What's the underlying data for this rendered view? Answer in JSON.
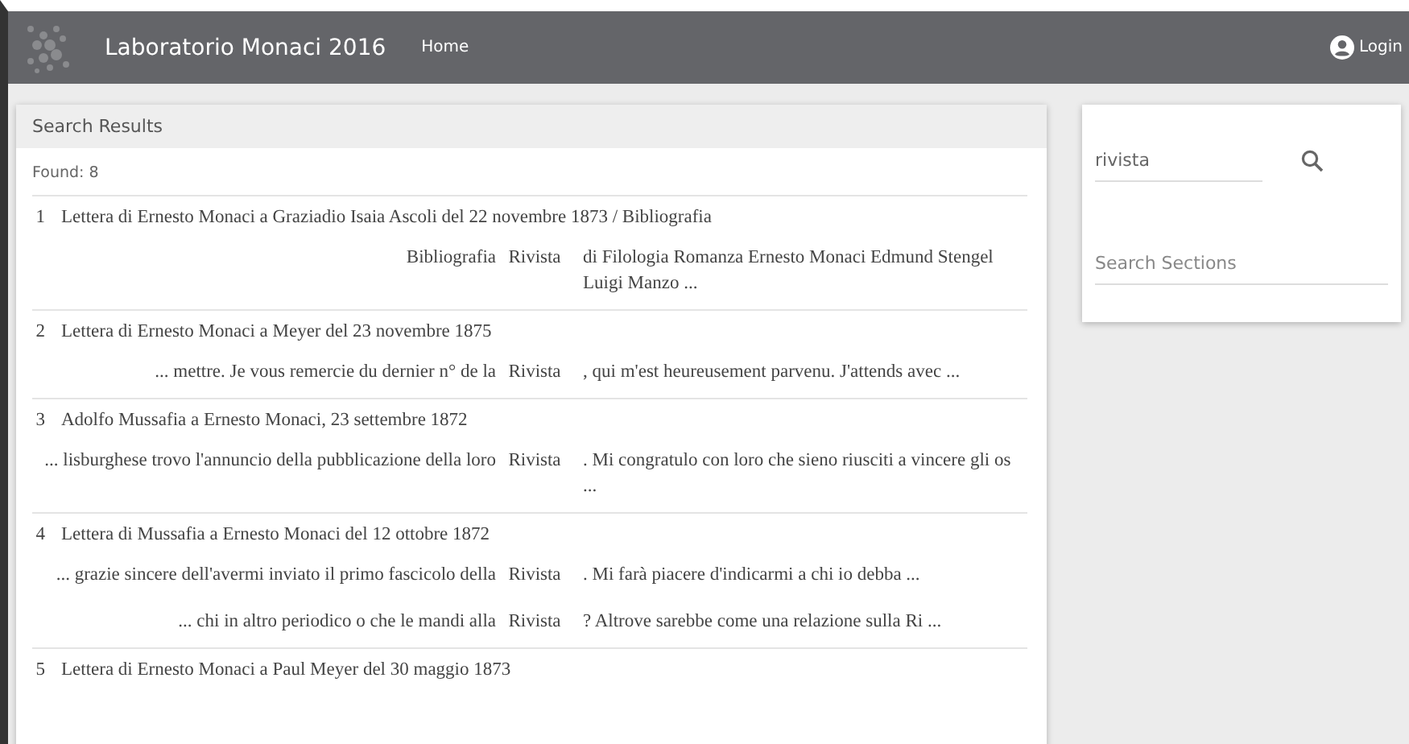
{
  "header": {
    "title": "Laboratorio Monaci 2016",
    "nav": [
      "Home"
    ],
    "login": "Login"
  },
  "results": {
    "title": "Search Results",
    "found": "Found: 8",
    "items": [
      {
        "number": "1",
        "title": "Lettera di Ernesto Monaci a Graziadio Isaia Ascoli del 22 novembre 1873 / Bibliografia",
        "snippets": [
          {
            "before": "Bibliografia",
            "keyword": "Rivista",
            "after": "di Filologia Romanza Ernesto Monaci Edmund Stengel Luigi Manzo ..."
          }
        ]
      },
      {
        "number": "2",
        "title": "Lettera di Ernesto Monaci a Meyer del 23 novembre 1875",
        "snippets": [
          {
            "before": "... mettre. Je vous remercie du dernier n° de la",
            "keyword": "Rivista",
            "after": ", qui m'est heureusement parvenu. J'attends avec ..."
          }
        ]
      },
      {
        "number": "3",
        "title": "Adolfo Mussafia a Ernesto Monaci, 23 settembre 1872",
        "snippets": [
          {
            "before": "... lisburghese trovo l'annuncio della pubblicazione della loro",
            "keyword": "Rivista",
            "after": ". Mi congratulo con loro che sieno riusciti a vincere gli os ..."
          }
        ]
      },
      {
        "number": "4",
        "title": "Lettera di Mussafia a Ernesto Monaci del 12 ottobre 1872",
        "snippets": [
          {
            "before": "... grazie sincere dell'avermi inviato il primo fascicolo della",
            "keyword": "Rivista",
            "after": ". Mi farà piacere d'indicarmi a chi io debba ..."
          },
          {
            "before": "... chi in altro periodico o che le mandi alla",
            "keyword": "Rivista",
            "after": "? Altrove sarebbe come una relazione sulla Ri ..."
          }
        ]
      },
      {
        "number": "5",
        "title": "Lettera di Ernesto Monaci a Paul Meyer del 30 maggio 1873"
      }
    ]
  },
  "sidebar": {
    "search": {
      "value": "rivista"
    },
    "sections": {
      "placeholder": "Search Sections"
    }
  }
}
